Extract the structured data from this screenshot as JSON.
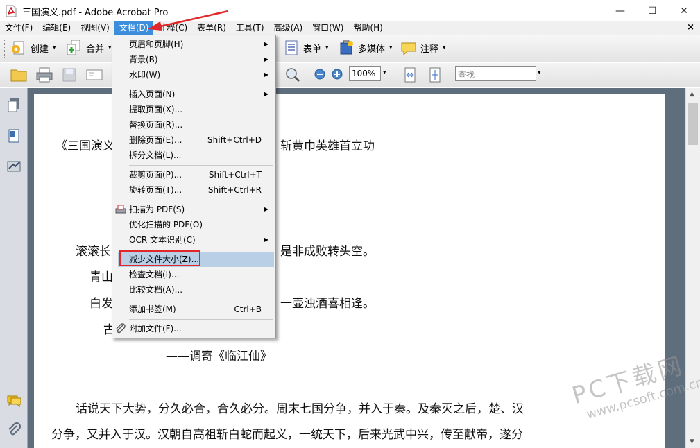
{
  "window": {
    "title": "三国演义.pdf - Adobe Acrobat Pro",
    "minimize": "—",
    "maximize": "☐",
    "close": "✕"
  },
  "menubar": {
    "items": [
      "文件(F)",
      "编辑(E)",
      "视图(V)",
      "文档(D)",
      "注释(C)",
      "表单(R)",
      "工具(T)",
      "高级(A)",
      "窗口(W)",
      "帮助(H)"
    ],
    "active_index": 3,
    "close_doc": "×"
  },
  "toolbar1": {
    "create": "创建",
    "combine": "合并",
    "forms": "表单",
    "multimedia": "多媒体",
    "comment": "注释"
  },
  "toolbar2": {
    "zoom": "100%",
    "find_placeholder": "查找"
  },
  "document_menu": {
    "items": [
      {
        "label": "页眉和页脚(H)",
        "shortcut": "",
        "submenu": true
      },
      {
        "label": "背景(B)",
        "shortcut": "",
        "submenu": true
      },
      {
        "label": "水印(W)",
        "shortcut": "",
        "submenu": true
      },
      {
        "label": "插入页面(N)",
        "shortcut": "",
        "submenu": true
      },
      {
        "label": "提取页面(X)...",
        "shortcut": "",
        "submenu": false
      },
      {
        "label": "替换页面(R)...",
        "shortcut": "",
        "submenu": false
      },
      {
        "label": "删除页面(E)...",
        "shortcut": "Shift+Ctrl+D",
        "submenu": false
      },
      {
        "label": "拆分文档(L)...",
        "shortcut": "",
        "submenu": false
      },
      {
        "label": "裁剪页面(P)...",
        "shortcut": "Shift+Ctrl+T",
        "submenu": false
      },
      {
        "label": "旋转页面(T)...",
        "shortcut": "Shift+Ctrl+R",
        "submenu": false
      },
      {
        "label": "扫描为 PDF(S)",
        "shortcut": "",
        "submenu": true
      },
      {
        "label": "优化扫描的 PDF(O)",
        "shortcut": "",
        "submenu": false
      },
      {
        "label": "OCR 文本识别(C)",
        "shortcut": "",
        "submenu": true
      },
      {
        "label": "减少文件大小(Z)...",
        "shortcut": "",
        "submenu": false,
        "highlighted": true
      },
      {
        "label": "检查文档(I)...",
        "shortcut": "",
        "submenu": false
      },
      {
        "label": "比较文档(A)...",
        "shortcut": "",
        "submenu": false
      },
      {
        "label": "添加书签(M)",
        "shortcut": "Ctrl+B",
        "submenu": false
      },
      {
        "label": "附加文件(F)...",
        "shortcut": "",
        "submenu": false
      }
    ]
  },
  "document": {
    "lines": [
      "《三国演义",
      "斩黄巾英雄首立功",
      "滚滚长",
      "是非成败转头空。",
      "青山",
      "白发",
      "一壶浊酒喜相逢。",
      "古",
      "——调寄《临江仙》",
      "话说天下大势，分久必合，合久必分。周末七国分争，并入于秦。及秦灭之后，楚、汉",
      "分争，又并入于汉。汉朝自高祖斩白蛇而起义，一统天下，后来光武中兴，传至献帝，遂分"
    ]
  },
  "watermark": {
    "brand": "PC下载网",
    "url": "www.pcsoft.com.cn"
  }
}
